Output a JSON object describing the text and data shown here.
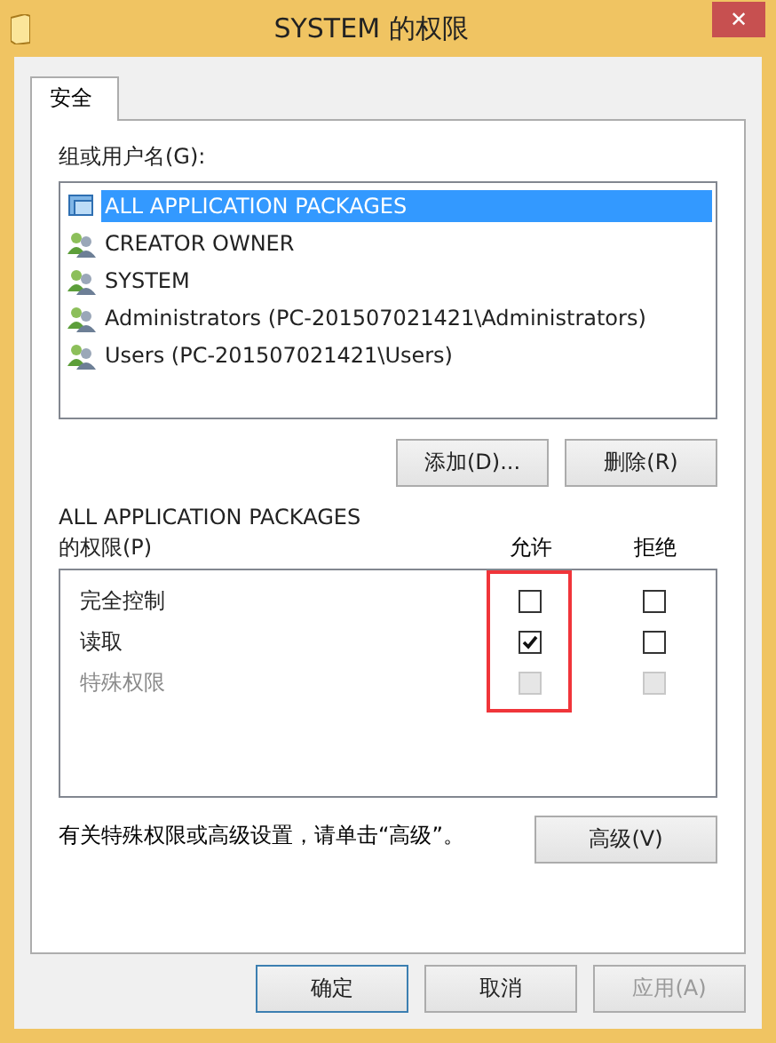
{
  "window": {
    "title": "SYSTEM 的权限",
    "close": "✕"
  },
  "tabs": [
    {
      "label": "安全",
      "selected": true
    }
  ],
  "groups": {
    "label": "组或用户名(G):",
    "items": [
      {
        "name": "ALL APPLICATION PACKAGES",
        "kind": "package",
        "selected": true
      },
      {
        "name": "CREATOR OWNER",
        "kind": "users",
        "selected": false
      },
      {
        "name": "SYSTEM",
        "kind": "users",
        "selected": false
      },
      {
        "name": "Administrators (PC-201507021421\\Administrators)",
        "kind": "users",
        "selected": false
      },
      {
        "name": "Users (PC-201507021421\\Users)",
        "kind": "users",
        "selected": false
      }
    ],
    "buttons": [
      {
        "label": "添加(D)..."
      },
      {
        "label": "删除(R)"
      }
    ]
  },
  "permissions": {
    "title": "ALL APPLICATION PACKAGES",
    "label": "的权限(P)",
    "columns": [
      {
        "label": "允许",
        "highlighted": true
      },
      {
        "label": "拒绝",
        "highlighted": false
      }
    ],
    "rows": [
      {
        "name": "完全控制",
        "allow": false,
        "deny": false,
        "disabled": false
      },
      {
        "name": "读取",
        "allow": true,
        "deny": false,
        "disabled": false
      },
      {
        "name": "特殊权限",
        "allow": false,
        "deny": false,
        "disabled": true
      }
    ]
  },
  "advanced": {
    "note": "有关特殊权限或高级设置，请单击“高级”。",
    "button": "高级(V)"
  },
  "footer": [
    {
      "label": "确定",
      "default": true,
      "disabled": false
    },
    {
      "label": "取消",
      "default": false,
      "disabled": false
    },
    {
      "label": "应用(A)",
      "default": false,
      "disabled": true
    }
  ]
}
